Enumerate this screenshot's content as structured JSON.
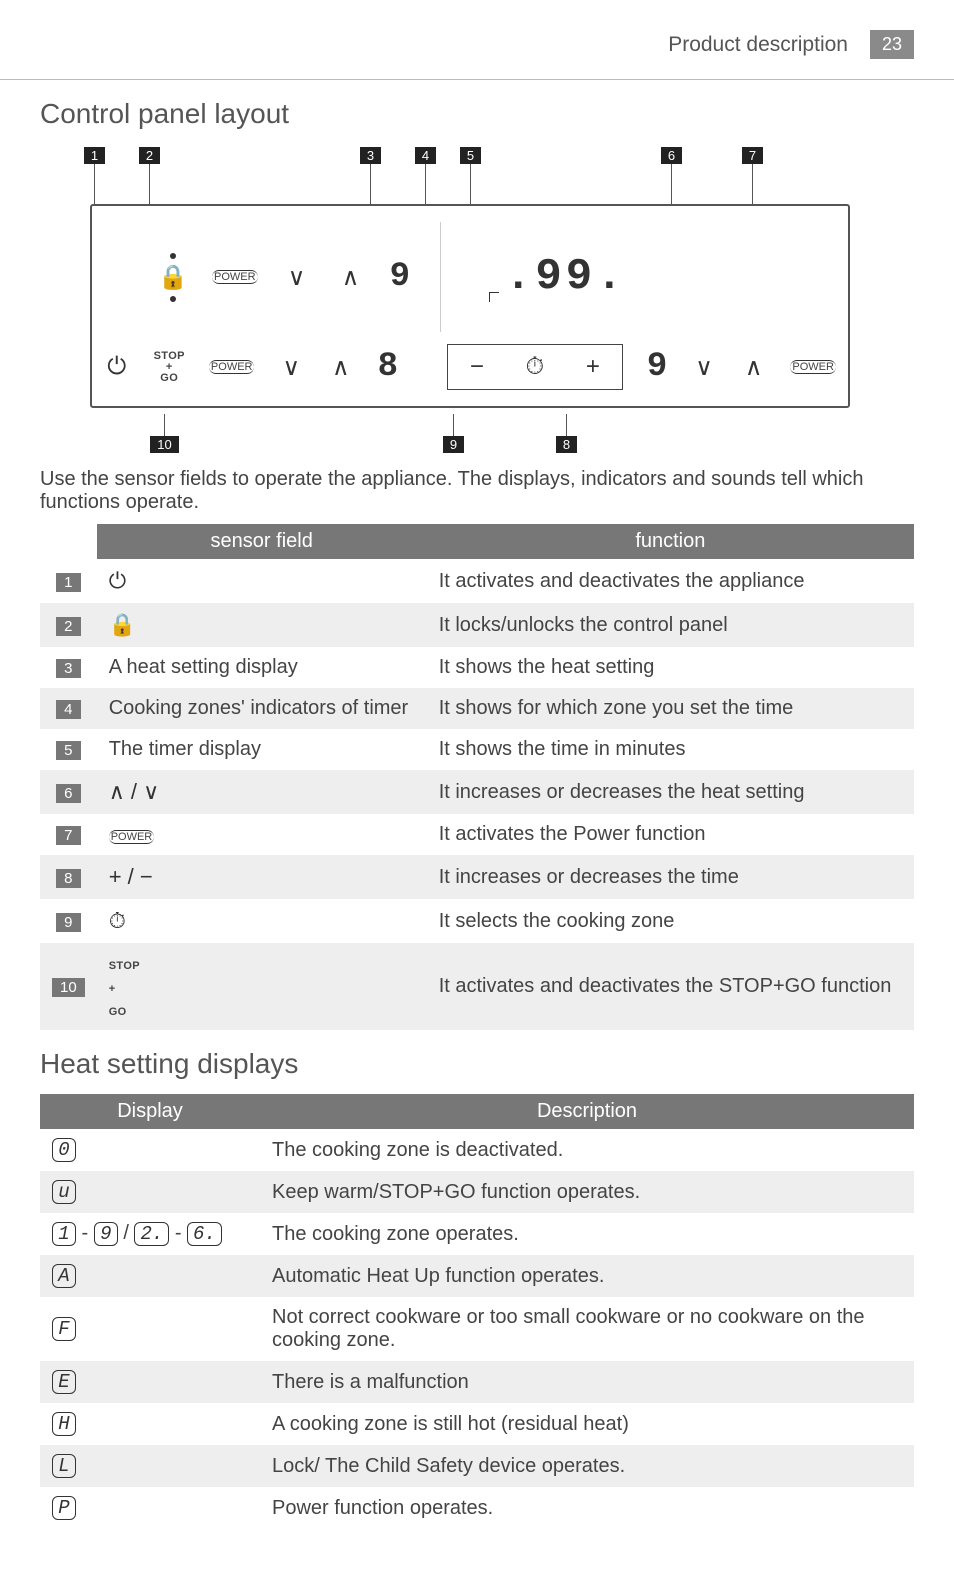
{
  "header": {
    "section": "Product description",
    "page": "23"
  },
  "headings": {
    "control_panel": "Control panel layout",
    "heat_displays": "Heat setting displays"
  },
  "intro": "Use the sensor fields to operate the appliance. The displays, indicators and sounds tell which functions operate.",
  "diagram": {
    "callouts_top": [
      "1",
      "2",
      "3",
      "4",
      "5",
      "6",
      "7"
    ],
    "callouts_bottom": [
      "10",
      "9",
      "8"
    ],
    "row1_digit": "9",
    "row2_digit": "8",
    "timer_value": ".99.",
    "row2_right_digit": "9",
    "power_label": "POWER",
    "stopgo_lines": [
      "STOP",
      "+",
      "GO"
    ]
  },
  "tbl1_headers": {
    "sensor": "sensor field",
    "function": "function"
  },
  "tbl1_rows": [
    {
      "n": "1",
      "sensor_sym": "⏻",
      "sensor_txt": "",
      "fn": "It activates and deactivates the appliance"
    },
    {
      "n": "2",
      "sensor_sym": "🔒",
      "sensor_txt": "",
      "fn": "It locks/unlocks the control panel"
    },
    {
      "n": "3",
      "sensor_sym": "",
      "sensor_txt": "A heat setting display",
      "fn": "It shows the heat setting"
    },
    {
      "n": "4",
      "sensor_sym": "",
      "sensor_txt": "Cooking zones' indicators of timer",
      "fn": "It shows for which zone you set the time"
    },
    {
      "n": "5",
      "sensor_sym": "",
      "sensor_txt": "The timer display",
      "fn": "It shows the time in minutes"
    },
    {
      "n": "6",
      "sensor_sym": "∧ / ∨",
      "sensor_txt": "",
      "fn": "It increases or decreases the heat setting"
    },
    {
      "n": "7",
      "sensor_sym": "POWER",
      "sensor_txt": "",
      "fn": "It activates the Power function"
    },
    {
      "n": "8",
      "sensor_sym": "+ / −",
      "sensor_txt": "",
      "fn": "It increases or decreases the time"
    },
    {
      "n": "9",
      "sensor_sym": "⏱",
      "sensor_txt": "",
      "fn": "It selects the cooking zone"
    },
    {
      "n": "10",
      "sensor_sym": "STOP+GO",
      "sensor_txt": "",
      "fn": "It activates and deactivates the STOP+GO function"
    }
  ],
  "tbl2_headers": {
    "display": "Display",
    "description": "Description"
  },
  "tbl2_rows": [
    {
      "disp": "0",
      "desc": "The cooking zone is deactivated."
    },
    {
      "disp": "u",
      "desc": "Keep warm/STOP+GO function operates."
    },
    {
      "disp": "1 - 9 / 2. - 6.",
      "desc": "The cooking zone operates."
    },
    {
      "disp": "A",
      "desc": "Automatic Heat Up function operates."
    },
    {
      "disp": "F",
      "desc": "Not correct cookware or too small cookware or no cookware on the cooking zone."
    },
    {
      "disp": "E",
      "desc": "There is a malfunction"
    },
    {
      "disp": "H",
      "desc": "A cooking zone is still hot (residual heat)"
    },
    {
      "disp": "L",
      "desc": "Lock/ The Child Safety device operates."
    },
    {
      "disp": "P",
      "desc": "Power function operates."
    }
  ]
}
